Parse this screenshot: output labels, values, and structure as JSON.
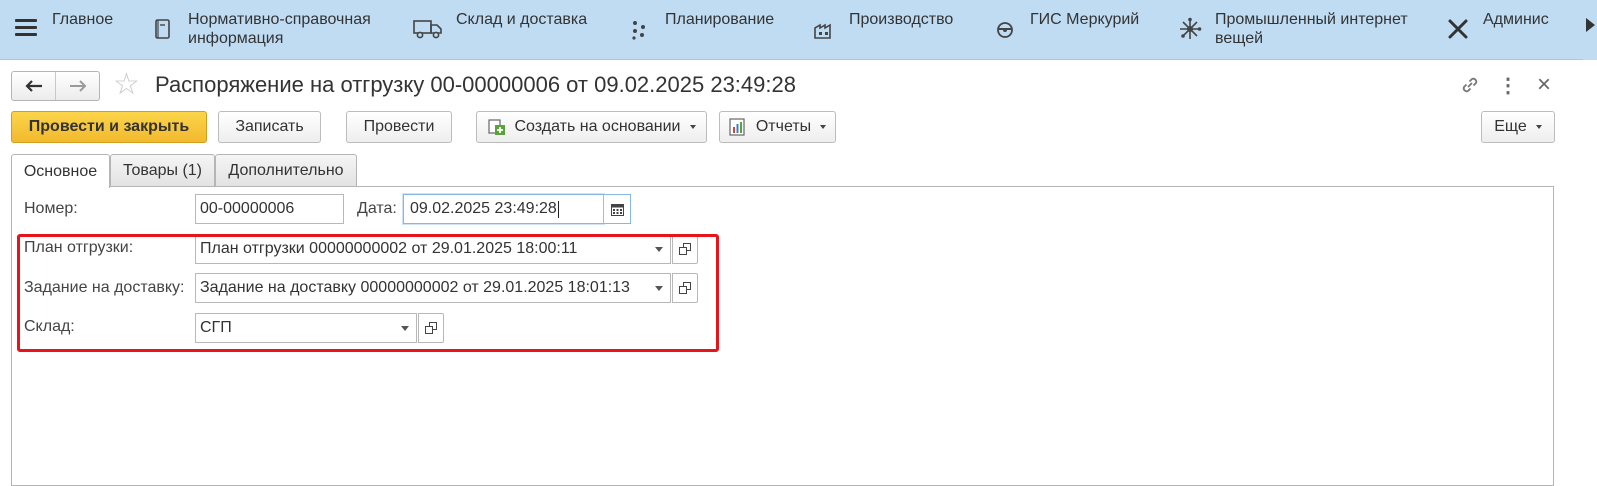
{
  "nav": {
    "items": [
      {
        "label": "Главное",
        "icon": "menu-icon"
      },
      {
        "label": "Нормативно-справочная\nинформация",
        "icon": "book-icon"
      },
      {
        "label": "Склад и доставка",
        "icon": "truck-icon"
      },
      {
        "label": "Планирование",
        "icon": "planning-icon"
      },
      {
        "label": "Производство",
        "icon": "factory-icon"
      },
      {
        "label": "ГИС Меркурий",
        "icon": "mercury-icon"
      },
      {
        "label": "Промышленный интернет\nвещей",
        "icon": "iot-icon"
      },
      {
        "label": "Админис",
        "icon": "tools-icon"
      }
    ]
  },
  "header": {
    "title": "Распоряжение на отгрузку 00-00000006 от 09.02.2025 23:49:28",
    "back_icon": "arrow-left-icon",
    "forward_icon": "arrow-right-icon",
    "star_glyph": "☆",
    "link_glyph": "🔗",
    "more_glyph": "⋮",
    "close_glyph": "×"
  },
  "toolbar": {
    "post_close_label": "Провести и закрыть",
    "save_label": "Записать",
    "post_label": "Провести",
    "create_based_label": "Создать на основании",
    "reports_label": "Отчеты",
    "more_label": "Еще"
  },
  "tabs": [
    {
      "label": "Основное",
      "active": true
    },
    {
      "label": "Товары (1)",
      "active": false
    },
    {
      "label": "Дополнительно",
      "active": false
    }
  ],
  "form": {
    "number_label": "Номер:",
    "number_value": "00-00000006",
    "date_label": "Дата:",
    "date_value": "09.02.2025 23:49:28",
    "plan_label": "План отгрузки:",
    "plan_value": "План отгрузки 00000000002 от 29.01.2025 18:00:11",
    "task_label": "Задание на доставку:",
    "task_value": "Задание на доставку 00000000002 от 29.01.2025 18:01:13",
    "warehouse_label": "Склад:",
    "warehouse_value": "СГП"
  },
  "colors": {
    "nav_bg": "#bfdcf3",
    "primary_button": "#f2b92e",
    "highlight": "#e8141b"
  }
}
